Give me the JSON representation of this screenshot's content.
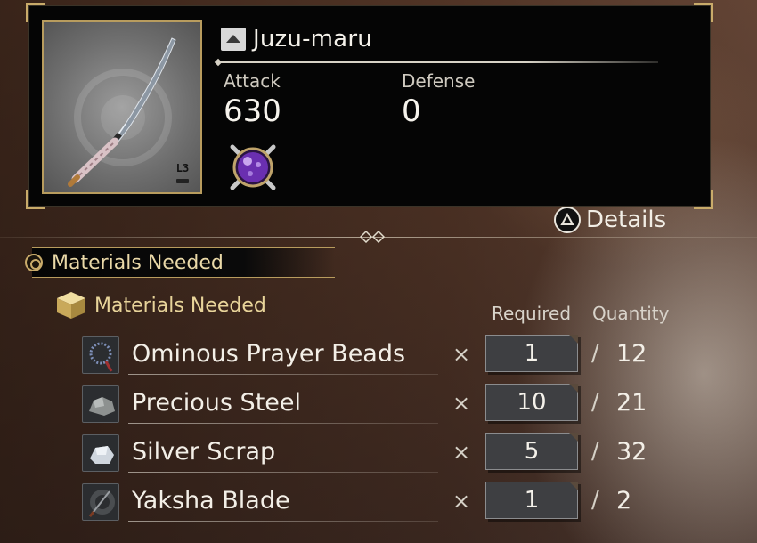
{
  "item": {
    "name": "Juzu-maru",
    "level_badge": "L3",
    "stats": [
      {
        "label": "Attack",
        "value": "630"
      },
      {
        "label": "Defense",
        "value": "0"
      }
    ]
  },
  "details": {
    "label": "Details",
    "button_icon": "triangle-button-icon"
  },
  "header_tab": {
    "label": "Materials Needed"
  },
  "category": {
    "label": "Materials Needed",
    "icon": "box-icon"
  },
  "columns": {
    "required": "Required",
    "quantity": "Quantity"
  },
  "materials": [
    {
      "name": "Ominous Prayer Beads",
      "multiplier": "×",
      "required": "1",
      "slash": "/",
      "quantity": "12",
      "icon": "prayer-beads-icon"
    },
    {
      "name": "Precious Steel",
      "multiplier": "×",
      "required": "10",
      "slash": "/",
      "quantity": "21",
      "icon": "steel-ore-icon"
    },
    {
      "name": "Silver Scrap",
      "multiplier": "×",
      "required": "5",
      "slash": "/",
      "quantity": "32",
      "icon": "silver-scrap-icon"
    },
    {
      "name": "Yaksha Blade",
      "multiplier": "×",
      "required": "1",
      "slash": "/",
      "quantity": "2",
      "icon": "blade-icon"
    }
  ],
  "colors": {
    "gold_accent": "#c9ab6a",
    "panel_bg": "#050505",
    "soul_core_purple": "#6a2fb0",
    "text": "#f2eee6"
  }
}
